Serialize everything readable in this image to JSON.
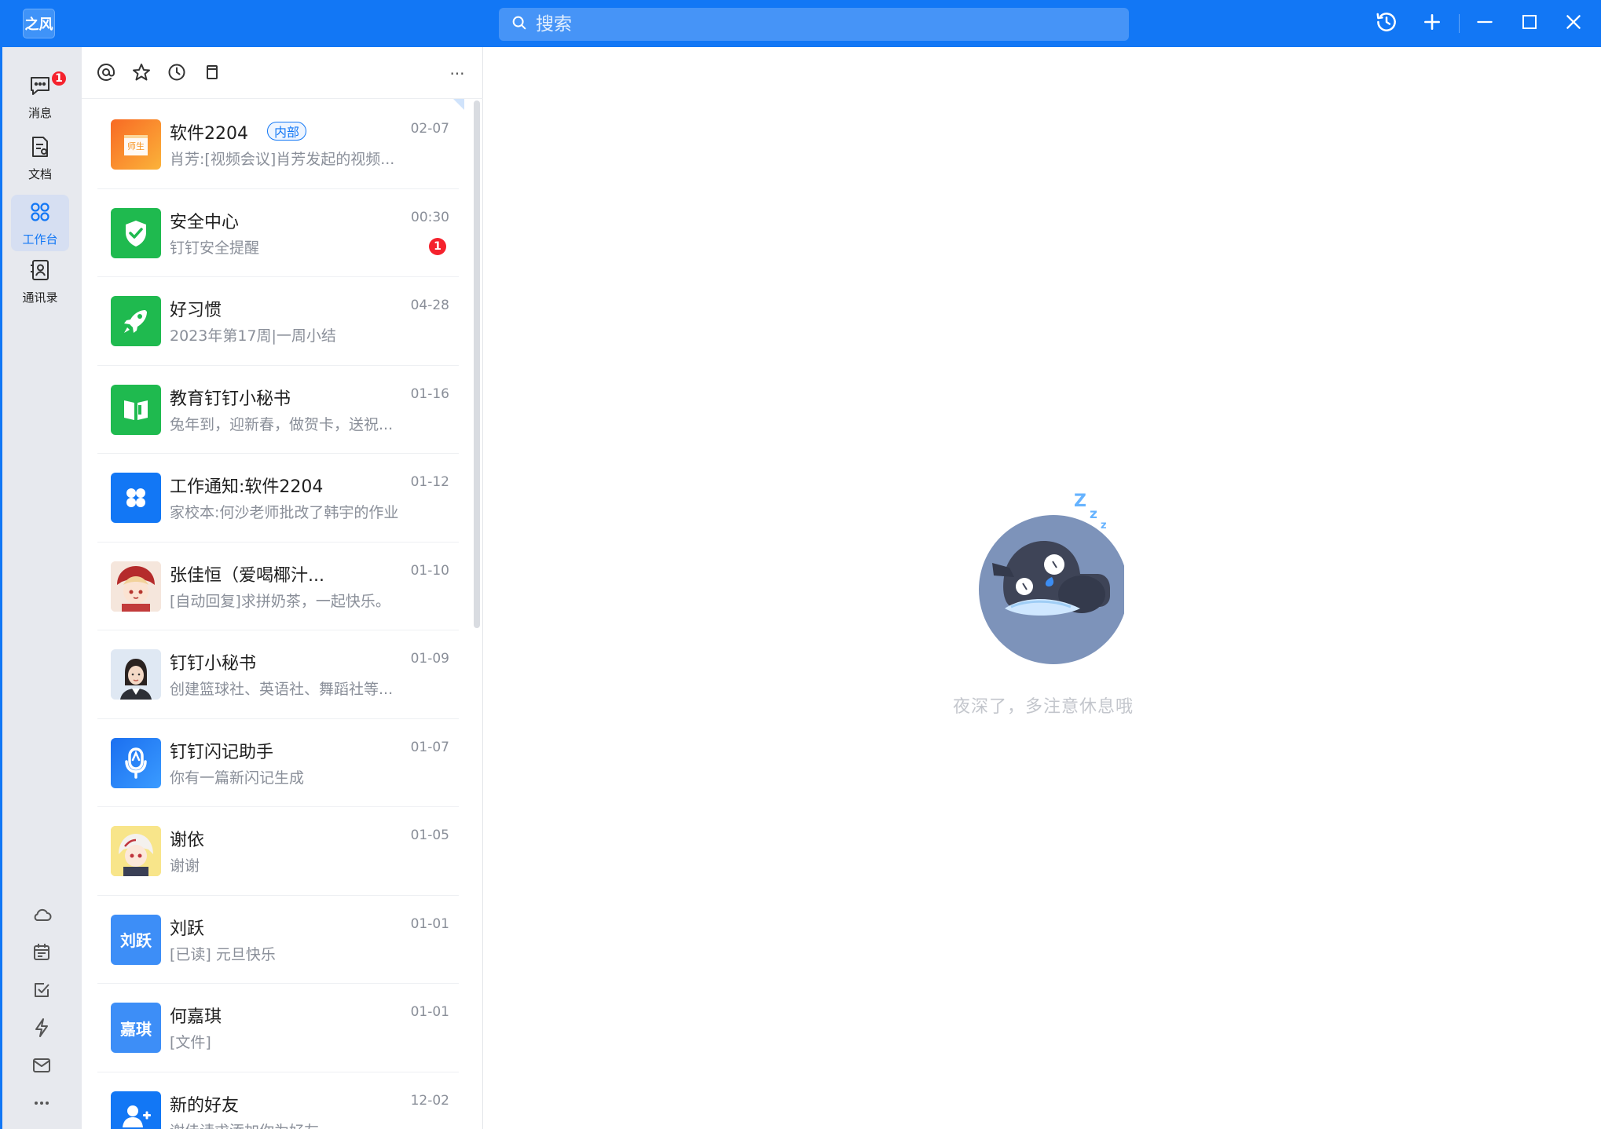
{
  "app": {
    "logo_text": "之风",
    "brand_color": "#1277f5"
  },
  "search": {
    "placeholder": "搜索"
  },
  "titlebar_icons": [
    "history-icon",
    "plus-icon",
    "minimize-icon",
    "maximize-icon",
    "close-icon"
  ],
  "nav": {
    "items": [
      {
        "label": "消息",
        "icon": "message-icon",
        "badge": "1",
        "active": false
      },
      {
        "label": "文档",
        "icon": "document-icon",
        "active": false
      },
      {
        "label": "工作台",
        "icon": "workbench-icon",
        "active": true
      },
      {
        "label": "通讯录",
        "icon": "contacts-icon",
        "active": false
      }
    ],
    "bottom_icons": [
      "cloud-icon",
      "calendar-icon",
      "todo-icon",
      "flash-icon",
      "mail-icon",
      "more-icon"
    ]
  },
  "list_toolbar": {
    "icons": [
      "at-icon",
      "star-icon",
      "clock-icon",
      "bookmark-icon"
    ],
    "more": "···"
  },
  "conversations": [
    {
      "name": "软件2204",
      "tag": "内部",
      "preview": "肖芳:[视频会议]肖芳发起的视频...",
      "time": "02-07",
      "avatar": "class-group-icon",
      "avatar_bg": "#f7931e"
    },
    {
      "name": "安全中心",
      "preview": "钉钉安全提醒",
      "time": "00:30",
      "unread": "1",
      "avatar": "shield-icon",
      "avatar_bg": "#1fba4f"
    },
    {
      "name": "好习惯",
      "preview": "2023年第17周|一周小结",
      "time": "04-28",
      "avatar": "rocket-icon",
      "avatar_bg": "#1fba4f"
    },
    {
      "name": "教育钉钉小秘书",
      "preview": "兔年到，迎新春，做贺卡，送祝...",
      "time": "01-16",
      "avatar": "book-icon",
      "avatar_bg": "#1fba4f"
    },
    {
      "name": "工作通知:软件2204",
      "preview": "家校本:何沙老师批改了韩宇的作业",
      "time": "01-12",
      "avatar": "apps-icon",
      "avatar_bg": "#1277f5"
    },
    {
      "name": "张佳恒（爱喝椰汁...",
      "preview": "[自动回复]求拼奶茶，一起快乐。",
      "time": "01-10",
      "avatar": "anime-avatar-icon",
      "avatar_bg": "#f3d7c4"
    },
    {
      "name": "钉钉小秘书",
      "preview": "创建篮球社、英语社、舞蹈社等...",
      "time": "01-09",
      "avatar": "assistant-avatar-icon",
      "avatar_bg": "#e8eef7"
    },
    {
      "name": "钉钉闪记助手",
      "preview": "你有一篇新闪记生成",
      "time": "01-07",
      "avatar": "microphone-icon",
      "avatar_bg": "#1277f5"
    },
    {
      "name": "谢依",
      "preview": "谢谢",
      "time": "01-05",
      "avatar": "anime-avatar-icon",
      "avatar_bg": "#f6e27a"
    },
    {
      "name": "刘跃",
      "preview": "[已读] 元旦快乐",
      "time": "01-01",
      "avatar_text": "刘跃",
      "avatar_bg": "#3d8ef7"
    },
    {
      "name": "何嘉琪",
      "preview": "[文件]",
      "time": "01-01",
      "avatar_text": "嘉琪",
      "avatar_bg": "#3d8ef7"
    },
    {
      "name": "新的好友",
      "preview": "谢佳请求添加你为好友",
      "time": "12-02",
      "avatar": "add-user-icon",
      "avatar_bg": "#1277f5"
    }
  ],
  "empty_state": {
    "text": "夜深了，多注意休息哦",
    "illustration": "sleeping-bird-icon"
  }
}
